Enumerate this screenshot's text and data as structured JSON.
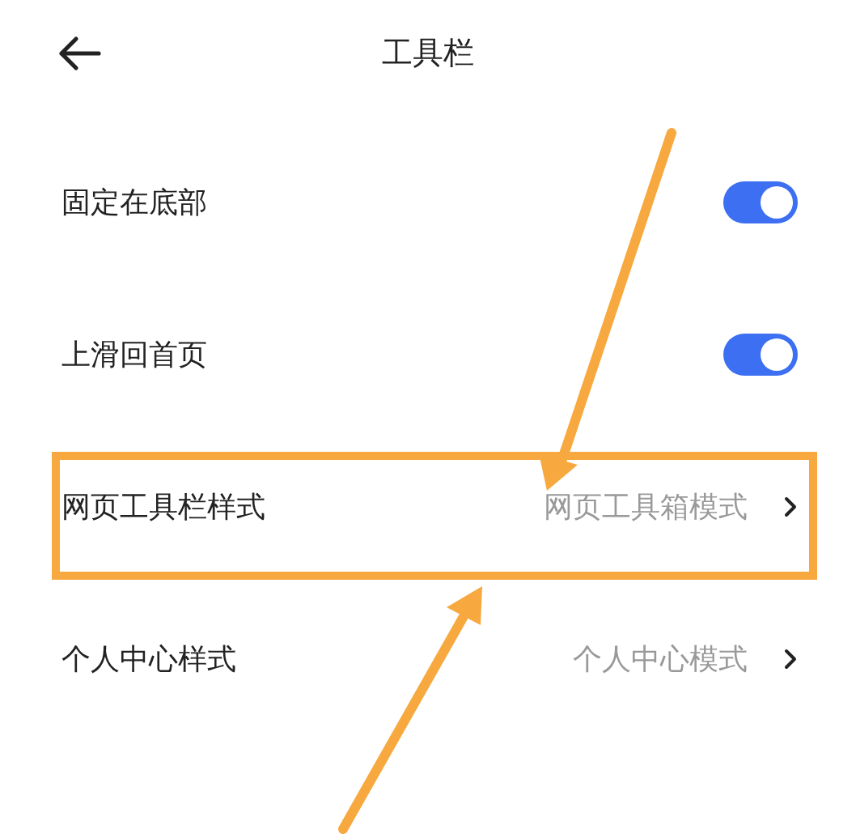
{
  "header": {
    "title": "工具栏"
  },
  "settings": [
    {
      "kind": "toggle",
      "label": "固定在底部",
      "on": true,
      "highlighted": false
    },
    {
      "kind": "toggle",
      "label": "上滑回首页",
      "on": true,
      "highlighted": false
    },
    {
      "kind": "choice",
      "label": "网页工具栏样式",
      "value": "网页工具箱模式",
      "highlighted": true
    },
    {
      "kind": "choice",
      "label": "个人中心样式",
      "value": "个人中心模式",
      "highlighted": false
    }
  ]
}
